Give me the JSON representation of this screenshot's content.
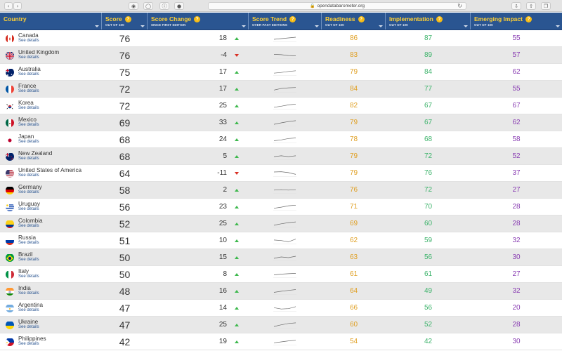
{
  "browser": {
    "url": "opendatabarometer.org"
  },
  "table": {
    "headers": [
      {
        "title": "Country",
        "sub": ""
      },
      {
        "title": "Score",
        "sub": "OUT OF 100"
      },
      {
        "title": "Score Change",
        "sub": "SINCE FIRST EDITION"
      },
      {
        "title": "Score Trend",
        "sub": "OVER PAST EDITIONS"
      },
      {
        "title": "Readiness",
        "sub": "OUT OF 100"
      },
      {
        "title": "Implementation",
        "sub": "OUT OF 100"
      },
      {
        "title": "Emerging Impact",
        "sub": "OUT OF 100"
      }
    ],
    "see_details_label": "See details",
    "help_icon_glyph": "?",
    "rows": [
      {
        "country": "Canada",
        "flag": "canada",
        "score": "76",
        "change": "18",
        "dir": "up",
        "readiness": "86",
        "implementation": "87",
        "impact": "55",
        "trend": [
          70,
          72,
          74,
          76
        ]
      },
      {
        "country": "United Kingdom",
        "flag": "uk",
        "score": "76",
        "change": "-4",
        "dir": "down",
        "readiness": "83",
        "implementation": "89",
        "impact": "57",
        "trend": [
          80,
          79,
          77,
          76
        ]
      },
      {
        "country": "Australia",
        "flag": "australia",
        "score": "75",
        "change": "17",
        "dir": "up",
        "readiness": "79",
        "implementation": "84",
        "impact": "62",
        "trend": [
          68,
          70,
          73,
          75
        ]
      },
      {
        "country": "France",
        "flag": "france",
        "score": "72",
        "change": "17",
        "dir": "up",
        "readiness": "84",
        "implementation": "77",
        "impact": "55",
        "trend": [
          64,
          69,
          71,
          72
        ]
      },
      {
        "country": "Korea",
        "flag": "korea",
        "score": "72",
        "change": "25",
        "dir": "up",
        "readiness": "82",
        "implementation": "67",
        "impact": "67",
        "trend": [
          60,
          64,
          69,
          72
        ]
      },
      {
        "country": "Mexico",
        "flag": "mexico",
        "score": "69",
        "change": "33",
        "dir": "up",
        "readiness": "79",
        "implementation": "67",
        "impact": "62",
        "trend": [
          52,
          59,
          65,
          69
        ]
      },
      {
        "country": "Japan",
        "flag": "japan",
        "score": "68",
        "change": "24",
        "dir": "up",
        "readiness": "78",
        "implementation": "68",
        "impact": "58",
        "trend": [
          58,
          61,
          66,
          68
        ]
      },
      {
        "country": "New Zealand",
        "flag": "newzealand",
        "score": "68",
        "change": "5",
        "dir": "up",
        "readiness": "79",
        "implementation": "72",
        "impact": "52",
        "trend": [
          66,
          68,
          66,
          68
        ]
      },
      {
        "country": "United States of America",
        "flag": "usa",
        "score": "64",
        "change": "-11",
        "dir": "down",
        "readiness": "79",
        "implementation": "76",
        "impact": "37",
        "trend": [
          72,
          73,
          70,
          64
        ]
      },
      {
        "country": "Germany",
        "flag": "germany",
        "score": "58",
        "change": "2",
        "dir": "up",
        "readiness": "76",
        "implementation": "72",
        "impact": "27",
        "trend": [
          57,
          58,
          57,
          58
        ]
      },
      {
        "country": "Uruguay",
        "flag": "uruguay",
        "score": "56",
        "change": "23",
        "dir": "up",
        "readiness": "71",
        "implementation": "70",
        "impact": "28",
        "trend": [
          45,
          49,
          54,
          56
        ]
      },
      {
        "country": "Colombia",
        "flag": "colombia",
        "score": "52",
        "change": "25",
        "dir": "up",
        "readiness": "69",
        "implementation": "60",
        "impact": "28",
        "trend": [
          38,
          44,
          49,
          52
        ]
      },
      {
        "country": "Russia",
        "flag": "russia",
        "score": "51",
        "change": "10",
        "dir": "up",
        "readiness": "62",
        "implementation": "59",
        "impact": "32",
        "trend": [
          48,
          46,
          42,
          51
        ]
      },
      {
        "country": "Brazil",
        "flag": "brazil",
        "score": "50",
        "change": "15",
        "dir": "up",
        "readiness": "63",
        "implementation": "56",
        "impact": "30",
        "trend": [
          44,
          48,
          46,
          50
        ]
      },
      {
        "country": "Italy",
        "flag": "italy",
        "score": "50",
        "change": "8",
        "dir": "up",
        "readiness": "61",
        "implementation": "61",
        "impact": "27",
        "trend": [
          46,
          48,
          49,
          50
        ]
      },
      {
        "country": "India",
        "flag": "india",
        "score": "48",
        "change": "16",
        "dir": "up",
        "readiness": "64",
        "implementation": "49",
        "impact": "32",
        "trend": [
          38,
          42,
          45,
          48
        ]
      },
      {
        "country": "Argentina",
        "flag": "argentina",
        "score": "47",
        "change": "14",
        "dir": "up",
        "readiness": "66",
        "implementation": "56",
        "impact": "20",
        "trend": [
          44,
          40,
          41,
          47
        ]
      },
      {
        "country": "Ukraine",
        "flag": "ukraine",
        "score": "47",
        "change": "25",
        "dir": "up",
        "readiness": "60",
        "implementation": "52",
        "impact": "28",
        "trend": [
          30,
          38,
          44,
          47
        ]
      },
      {
        "country": "Philippines",
        "flag": "philippines",
        "score": "42",
        "change": "19",
        "dir": "up",
        "readiness": "54",
        "implementation": "42",
        "impact": "30",
        "trend": [
          34,
          37,
          40,
          42
        ]
      }
    ]
  }
}
